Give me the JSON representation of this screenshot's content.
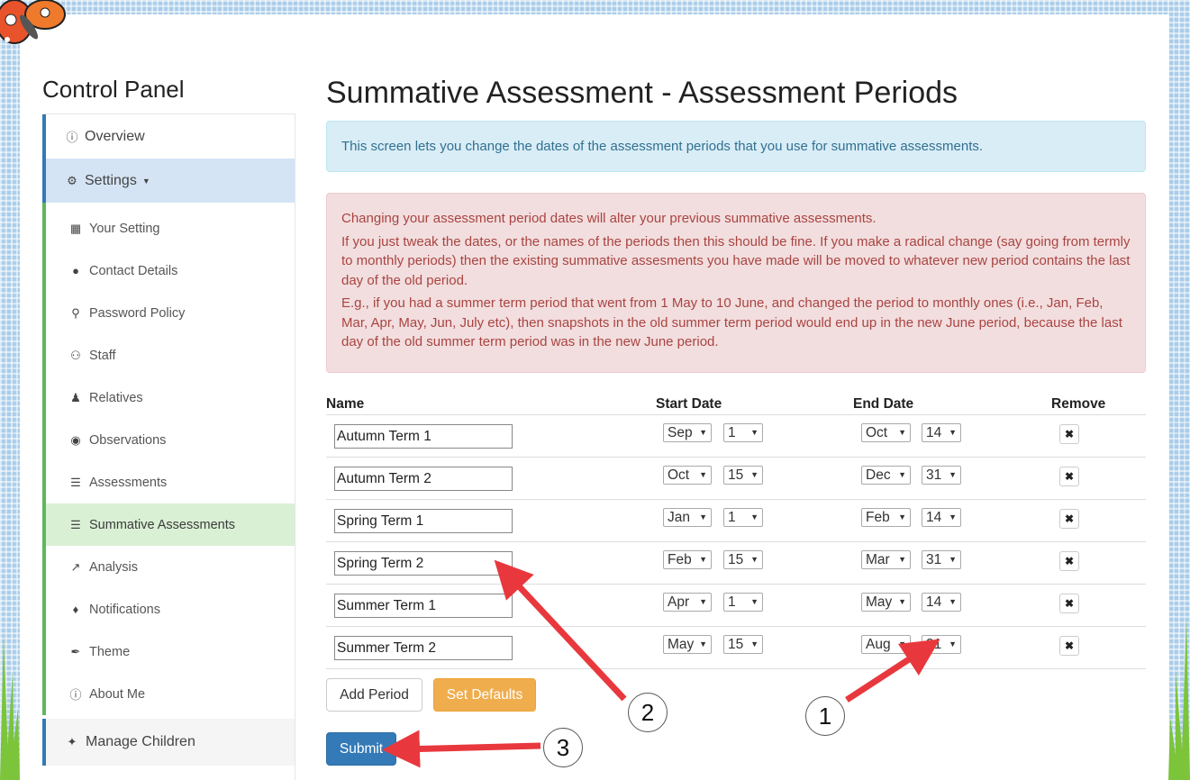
{
  "sidebar": {
    "title": "Control Panel",
    "overview": "Overview",
    "settings": "Settings",
    "items": [
      {
        "label": "Your Setting",
        "icon": "building-icon"
      },
      {
        "label": "Contact Details",
        "icon": "comment-icon"
      },
      {
        "label": "Password Policy",
        "icon": "key-icon"
      },
      {
        "label": "Staff",
        "icon": "users-icon"
      },
      {
        "label": "Relatives",
        "icon": "user-icon"
      },
      {
        "label": "Observations",
        "icon": "eye-icon"
      },
      {
        "label": "Assessments",
        "icon": "list-icon"
      },
      {
        "label": "Summative Assessments",
        "icon": "list-icon"
      },
      {
        "label": "Analysis",
        "icon": "chart-icon"
      },
      {
        "label": "Notifications",
        "icon": "bell-icon"
      },
      {
        "label": "Theme",
        "icon": "brush-icon"
      },
      {
        "label": "About Me",
        "icon": "info-icon"
      }
    ],
    "manage_children": "Manage Children"
  },
  "main": {
    "title": "Summative Assessment - Assessment Periods",
    "info": "This screen lets you change the dates of the assessment periods that you use for summative assessments.",
    "warning": [
      "Changing your assessment period dates will alter your previous summative assessments.",
      "If you just tweak the dates, or the names of the periods then this should be fine. If you make a radical change (say going from termly to monthly periods) then the existing summative assesments you have made will be moved to whatever new period contains the last day of the old period.",
      "E.g., if you had a summer term period that went from 1 May to 10 June, and changed the period to monthly ones (i.e., Jan, Feb, Mar, Apr, May, Jun, July etc), then snapshots in the old summer term period would end up in the new June period, because the last day of the old summer term period was in the new June period."
    ],
    "table": {
      "headers": {
        "name": "Name",
        "start": "Start Date",
        "end": "End Date",
        "remove": "Remove"
      },
      "rows": [
        {
          "name": "Autumn Term 1",
          "start_month": "Sep",
          "start_day": "1",
          "end_month": "Oct",
          "end_day": "14"
        },
        {
          "name": "Autumn Term 2",
          "start_month": "Oct",
          "start_day": "15",
          "end_month": "Dec",
          "end_day": "31"
        },
        {
          "name": "Spring Term 1",
          "start_month": "Jan",
          "start_day": "1",
          "end_month": "Feb",
          "end_day": "14"
        },
        {
          "name": "Spring Term 2",
          "start_month": "Feb",
          "start_day": "15",
          "end_month": "Mar",
          "end_day": "31"
        },
        {
          "name": "Summer Term 1",
          "start_month": "Apr",
          "start_day": "1",
          "end_month": "May",
          "end_day": "14"
        },
        {
          "name": "Summer Term 2",
          "start_month": "May",
          "start_day": "15",
          "end_month": "Aug",
          "end_day": "31"
        }
      ]
    },
    "buttons": {
      "add": "Add Period",
      "defaults": "Set Defaults",
      "submit": "Submit"
    }
  },
  "callouts": [
    "1",
    "2",
    "3"
  ],
  "colors": {
    "primary": "#337ab7",
    "warning": "#f0ad4e",
    "arrow": "#e8383d"
  }
}
